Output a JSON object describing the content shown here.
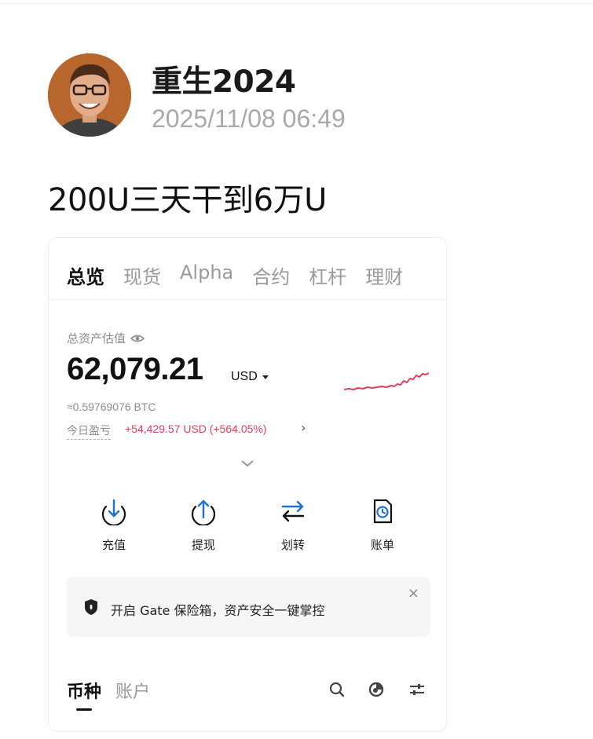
{
  "post": {
    "author": "重生2024",
    "timestamp": "2025/11/08 06:49",
    "text": "200U三天干到6万U"
  },
  "card": {
    "tabs": [
      "总览",
      "现货",
      "Alpha",
      "合约",
      "杠杆",
      "理财"
    ],
    "active_tab": "总览",
    "asset_label": "总资产估值",
    "balance": "62,079.21",
    "currency": "USD",
    "btc_equivalent": "≈0.59769076 BTC",
    "pnl_label": "今日盈亏",
    "pnl_value": "+54,429.57 USD (+564.05%)",
    "pnl_color": "#e0405e",
    "actions": [
      {
        "label": "充值",
        "icon": "deposit-arrow-down-icon"
      },
      {
        "label": "提现",
        "icon": "withdraw-arrow-up-icon"
      },
      {
        "label": "划转",
        "icon": "transfer-arrows-icon"
      },
      {
        "label": "账单",
        "icon": "bill-clock-icon"
      }
    ],
    "action_icon_color": "#1e6fd9",
    "notice_text": "开启 Gate 保险箱，资产安全一键掌控",
    "notice_close": "×",
    "bottom_tabs": [
      "币种",
      "账户"
    ],
    "active_bottom_tab": "币种"
  }
}
